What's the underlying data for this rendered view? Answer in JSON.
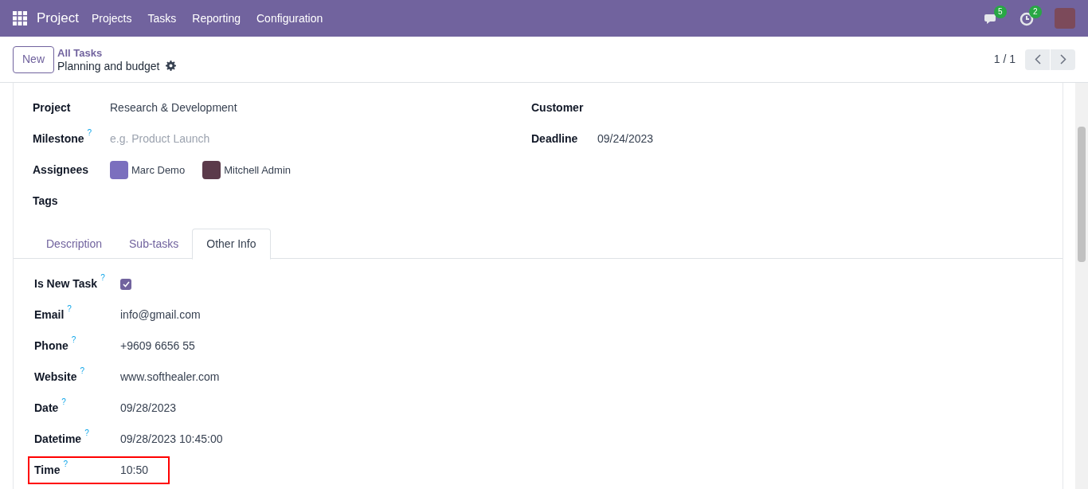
{
  "navbar": {
    "app": "Project",
    "menu": [
      "Projects",
      "Tasks",
      "Reporting",
      "Configuration"
    ],
    "messages_badge": "5",
    "activities_badge": "2"
  },
  "control_panel": {
    "new_button": "New",
    "breadcrumb": "All Tasks",
    "record": "Planning and budget",
    "pager": "1 / 1"
  },
  "form": {
    "left_fields": [
      {
        "label": "Project",
        "value": "Research & Development"
      },
      {
        "label": "Milestone",
        "help": "?",
        "placeholder": "e.g. Product Launch"
      },
      {
        "label": "Assignees",
        "assignees": [
          "Marc Demo",
          "Mitchell Admin"
        ]
      },
      {
        "label": "Tags"
      }
    ],
    "right_fields": [
      {
        "label": "Customer"
      },
      {
        "label": "Deadline",
        "value": "09/24/2023"
      }
    ],
    "tabs": [
      {
        "label": "Description",
        "selected": false
      },
      {
        "label": "Sub-tasks",
        "selected": false
      },
      {
        "label": "Other Info",
        "selected": true
      }
    ],
    "other_info": [
      {
        "kind": "checkbox",
        "label": "Is New Task",
        "help": "?",
        "checked": true,
        "highlighted": false
      },
      {
        "kind": "text",
        "label": "Email",
        "help": "?",
        "value": "info@gmail.com",
        "highlighted": false
      },
      {
        "kind": "text",
        "label": "Phone",
        "help": "?",
        "value": "+9609 6656 55",
        "highlighted": false
      },
      {
        "kind": "text",
        "label": "Website",
        "help": "?",
        "value": "www.softhealer.com",
        "highlighted": false
      },
      {
        "kind": "text",
        "label": "Date",
        "help": "?",
        "value": "09/28/2023",
        "highlighted": false
      },
      {
        "kind": "text",
        "label": "Datetime",
        "help": "?",
        "value": "09/28/2023 10:45:00",
        "highlighted": false
      },
      {
        "kind": "text",
        "label": "Time",
        "help": "?",
        "value": "10:50",
        "highlighted": true
      }
    ]
  }
}
